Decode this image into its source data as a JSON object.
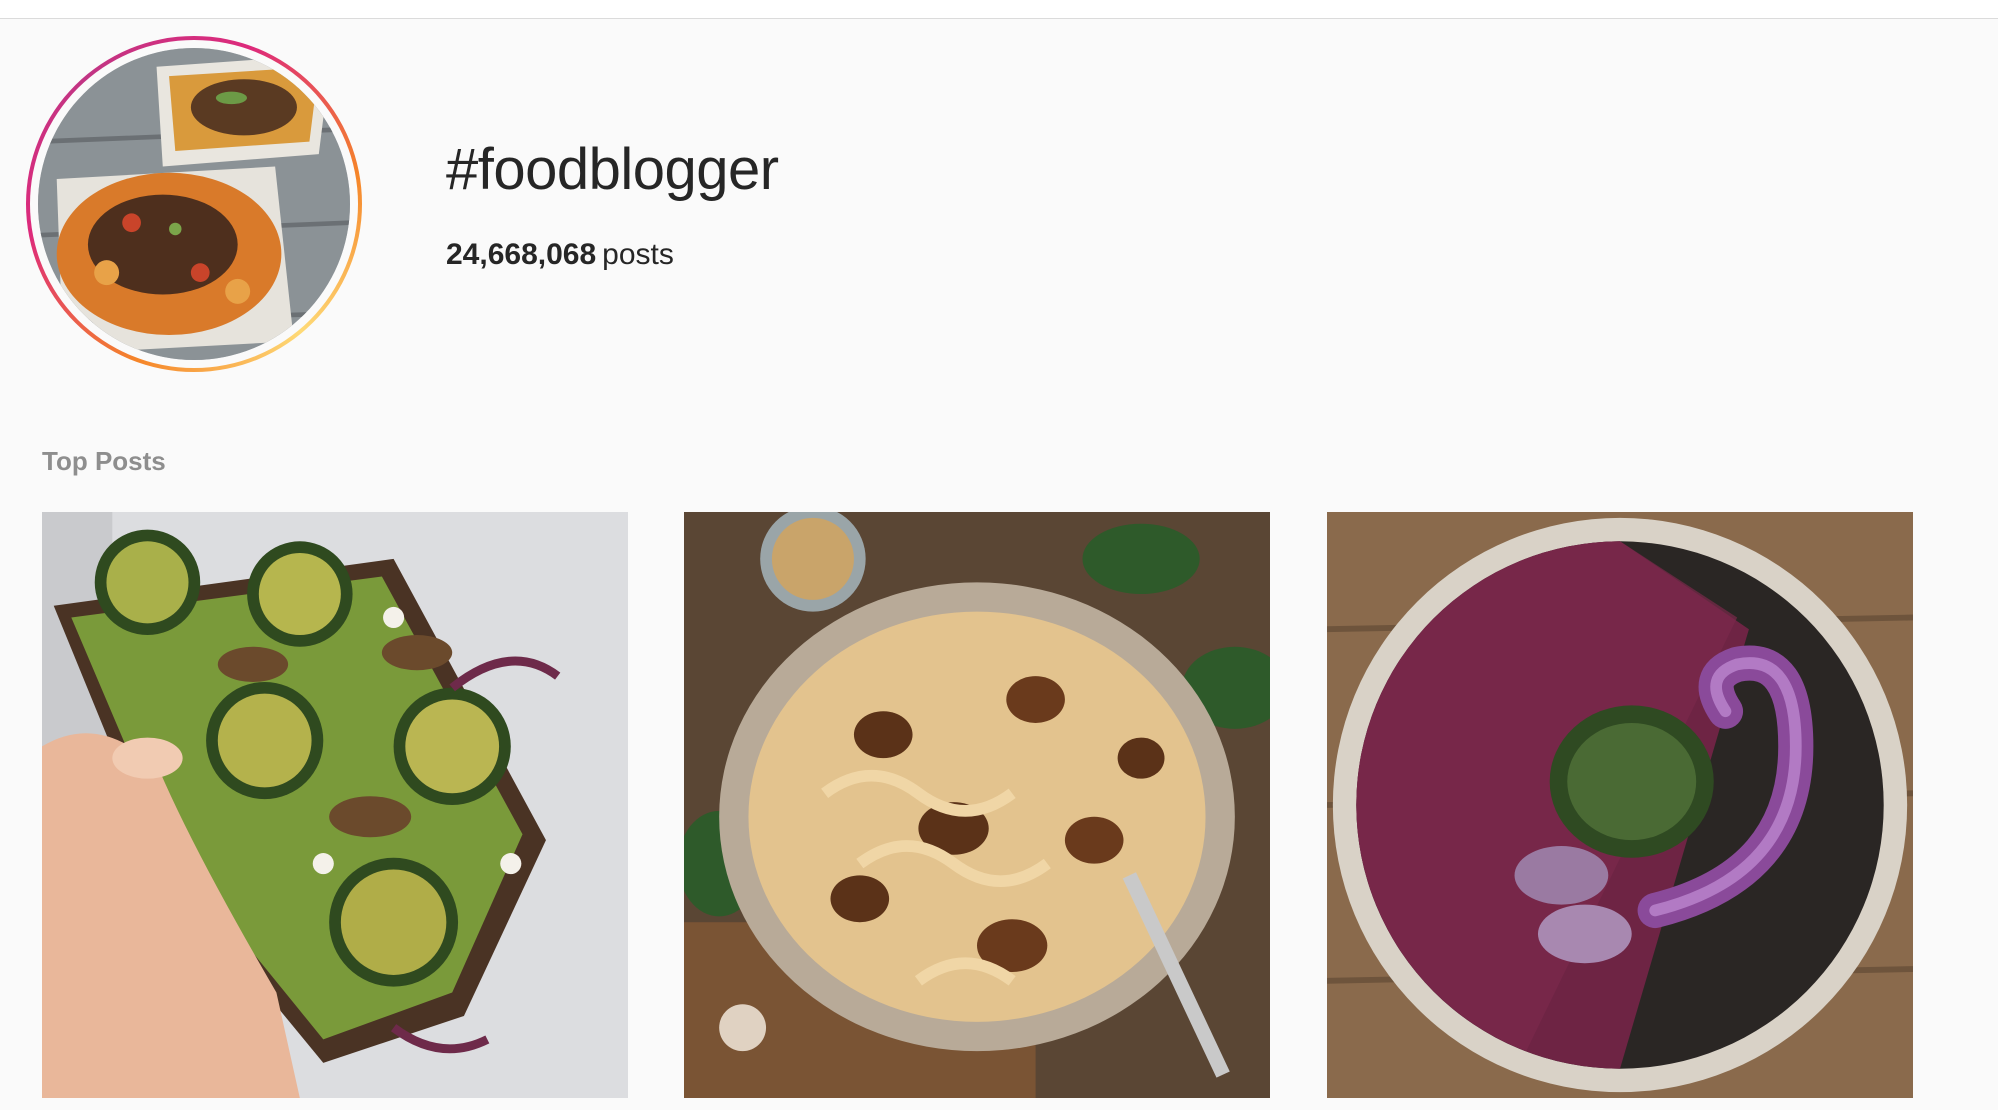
{
  "hashtag": {
    "title": "#foodblogger",
    "post_count": "24,668,068",
    "post_count_suffix": "posts"
  },
  "top_posts": {
    "label": "Top Posts"
  },
  "colors": {
    "background": "#fafafa",
    "text": "#262626",
    "muted": "#8e8e8e",
    "ring_start": "#f58529",
    "ring_end": "#c13584"
  }
}
